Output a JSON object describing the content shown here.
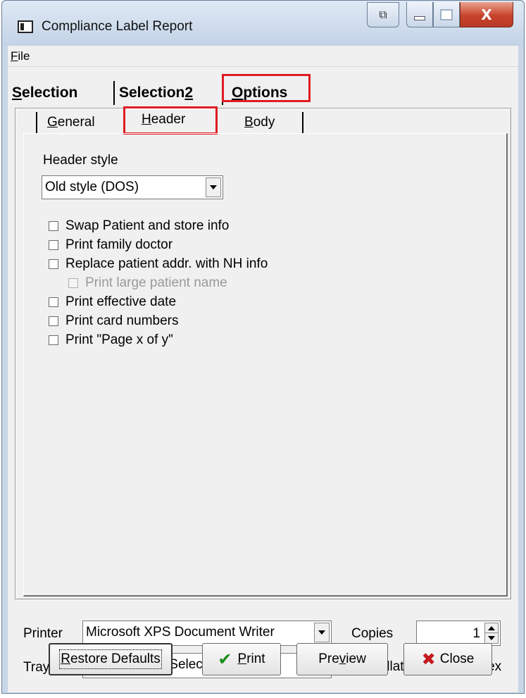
{
  "window": {
    "title": "Compliance Label Report",
    "extra_button_glyph": "⧉",
    "close_glyph": "X"
  },
  "menu": {
    "file": {
      "accel": "F",
      "rest": "ile"
    }
  },
  "outer_tabs": [
    {
      "label_pre": "",
      "accel": "S",
      "label_post": "election"
    },
    {
      "label_pre": "Selection ",
      "accel": "2",
      "label_post": ""
    },
    {
      "label_pre": "",
      "accel": "O",
      "label_post": "ptions"
    }
  ],
  "sub_tabs": [
    {
      "accel": "G",
      "rest": "eneral"
    },
    {
      "accel": "H",
      "rest": "eader"
    },
    {
      "accel": "B",
      "rest": "ody"
    }
  ],
  "header": {
    "style_label": "Header style",
    "style_value": "Old style (DOS)"
  },
  "checkboxes": [
    {
      "label": "Swap Patient and store info",
      "checked": false,
      "enabled": true
    },
    {
      "label": "Print family doctor",
      "checked": false,
      "enabled": true
    },
    {
      "label": "Replace patient addr. with NH info",
      "checked": false,
      "enabled": true
    },
    {
      "label": "Print large patient name",
      "checked": false,
      "enabled": false
    },
    {
      "label": "Print effective date",
      "checked": false,
      "enabled": true
    },
    {
      "label": "Print card numbers",
      "checked": false,
      "enabled": true
    },
    {
      "label": "Print \"Page x of y\"",
      "checked": false,
      "enabled": true
    }
  ],
  "printer": {
    "label": "Printer",
    "value": "Microsoft XPS Document Writer"
  },
  "tray": {
    "label": "Tray",
    "value": "Automatically Select"
  },
  "copies": {
    "label": "Copies",
    "value": "1"
  },
  "collate": {
    "label": "Collate",
    "checked": false
  },
  "duplex": {
    "label": "Duplex",
    "checked": false
  },
  "buttons": {
    "restore": {
      "accel": "R",
      "rest": "estore Defaults"
    },
    "print": {
      "accel": "P",
      "rest": "rint",
      "icon": "checkmark-icon",
      "icon_glyph": "✔",
      "icon_color": "#1c8e1c"
    },
    "preview": {
      "pre": "Pre",
      "accel": "v",
      "rest": "iew"
    },
    "close": {
      "label": "Close",
      "icon": "x-icon",
      "icon_glyph": "✖",
      "icon_color": "#c4191d"
    }
  },
  "highlight_color": "#e01b22"
}
